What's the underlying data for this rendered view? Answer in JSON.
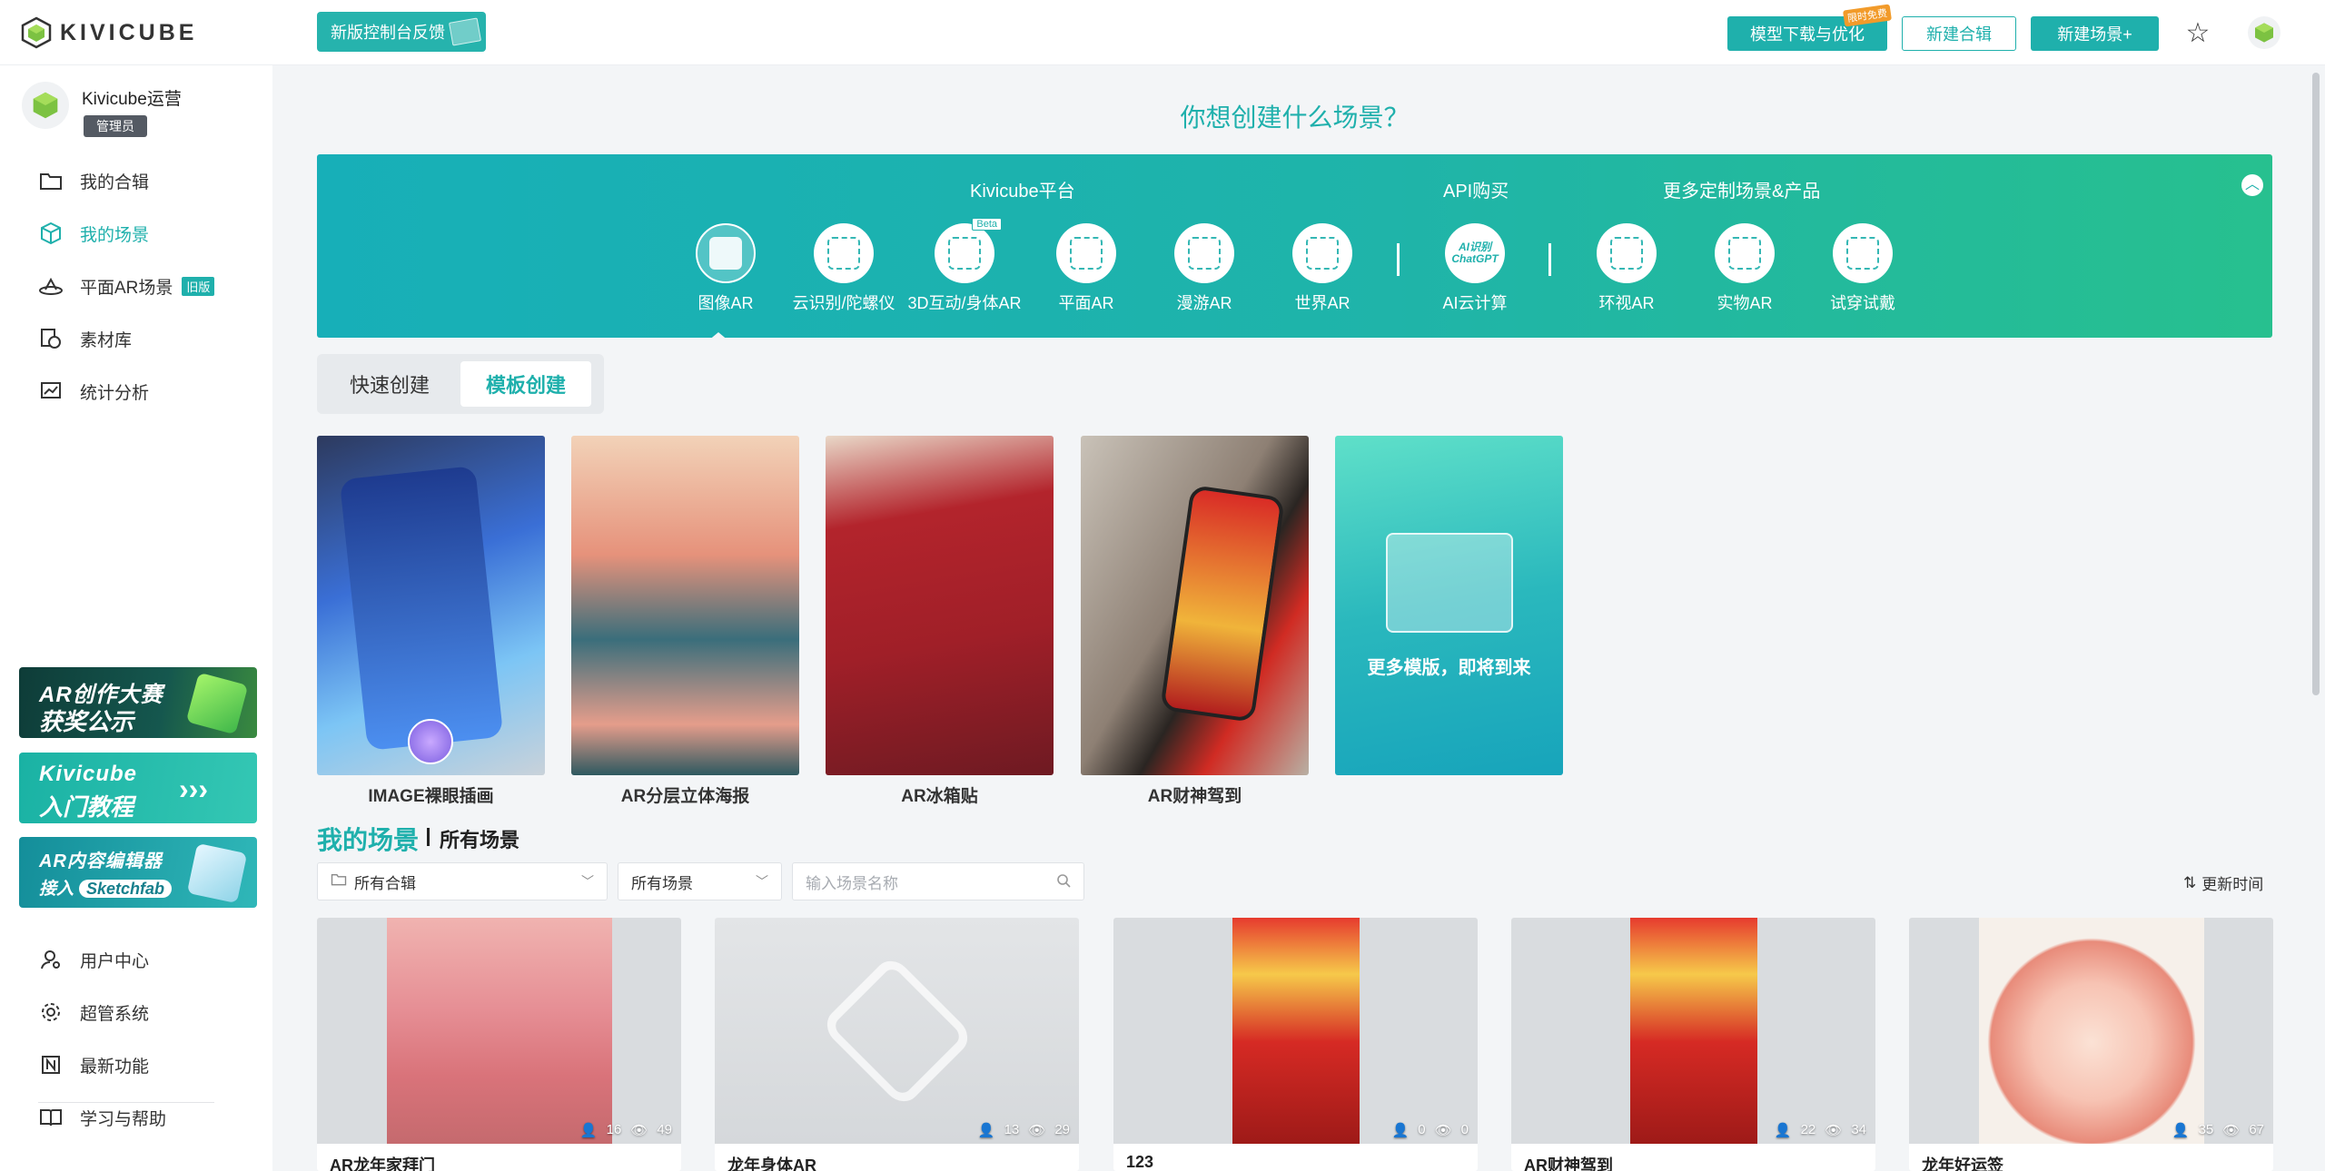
{
  "app": {
    "logo_text": "KIVICUBE"
  },
  "topbar": {
    "feedback_label": "新版控制台反馈",
    "model_label": "模型下载与优化",
    "model_badge": "限时免费",
    "collection_label": "新建合辑",
    "new_scene_label": "新建场景+"
  },
  "user": {
    "name": "Kivicube运营",
    "role": "管理员"
  },
  "sidebar": {
    "items": [
      {
        "label": "我的合辑",
        "icon": "folder-icon"
      },
      {
        "label": "我的场景",
        "icon": "cube-icon"
      },
      {
        "label": "平面AR场景",
        "icon": "plane-ar-icon",
        "tag": "旧版"
      },
      {
        "label": "素材库",
        "icon": "material-icon"
      },
      {
        "label": "统计分析",
        "icon": "chart-icon"
      }
    ],
    "bottom_items": [
      {
        "label": "用户中心",
        "icon": "user-icon"
      },
      {
        "label": "超管系统",
        "icon": "settings-icon"
      },
      {
        "label": "最新功能",
        "icon": "new-icon"
      },
      {
        "label": "学习与帮助",
        "icon": "book-icon"
      }
    ],
    "promos": [
      {
        "line1": "AR创作大赛",
        "line2": "获奖公示"
      },
      {
        "line1": "Kivicube",
        "line2": "入门教程"
      },
      {
        "line1": "AR内容编辑器",
        "line2": "接入",
        "badge": "Sketchfab"
      }
    ]
  },
  "main": {
    "title": "你想创建什么场景？",
    "banner": {
      "group_platform": "Kivicube平台",
      "group_api": "API购买",
      "group_custom": "更多定制场景&产品",
      "items": [
        {
          "label": "图像AR",
          "icon": "image-ar-icon"
        },
        {
          "label": "云识别/陀螺仪",
          "icon": "cloud-recognition-icon"
        },
        {
          "label": "3D互动/身体AR",
          "icon": "body-ar-icon",
          "badge": "Beta"
        },
        {
          "label": "平面AR",
          "icon": "plane-ar-icon"
        },
        {
          "label": "漫游AR",
          "icon": "roaming-ar-icon"
        },
        {
          "label": "世界AR",
          "icon": "world-ar-icon"
        },
        {
          "label": "AI云计算",
          "icon": "ai-chatgpt-icon",
          "icon_text1": "AI识别",
          "icon_text2": "ChatGPT"
        },
        {
          "label": "环视AR",
          "icon": "surround-ar-icon"
        },
        {
          "label": "实物AR",
          "icon": "object-ar-icon"
        },
        {
          "label": "试穿试戴",
          "icon": "try-on-icon"
        }
      ]
    },
    "tabs": [
      "快速创建",
      "模板创建"
    ],
    "templates": [
      {
        "label": "IMAGE裸眼插画"
      },
      {
        "label": "AR分层立体海报"
      },
      {
        "label": "AR冰箱贴"
      },
      {
        "label": "AR财神驾到"
      }
    ],
    "more_templates": "更多模版，即将到来",
    "scenes_title": "我的场景",
    "scenes_all": "所有场景",
    "filters": {
      "collection": "所有合辑",
      "scene_type": "所有场景",
      "search_placeholder": "输入场景名称"
    },
    "sort_label": "更新时间",
    "cards": [
      {
        "title": "AR龙年家拜门",
        "users": "16",
        "views": "49"
      },
      {
        "title": "龙年身体AR",
        "users": "13",
        "views": "29"
      },
      {
        "title": "123",
        "users": "0",
        "views": "0"
      },
      {
        "title": "AR财神驾到",
        "users": "22",
        "views": "34"
      },
      {
        "title": "龙年好运签",
        "users": "35",
        "views": "67"
      }
    ]
  },
  "colors": {
    "accent": "#1fb0ac",
    "banner_start": "#17afb8",
    "banner_end": "#27c08f"
  }
}
